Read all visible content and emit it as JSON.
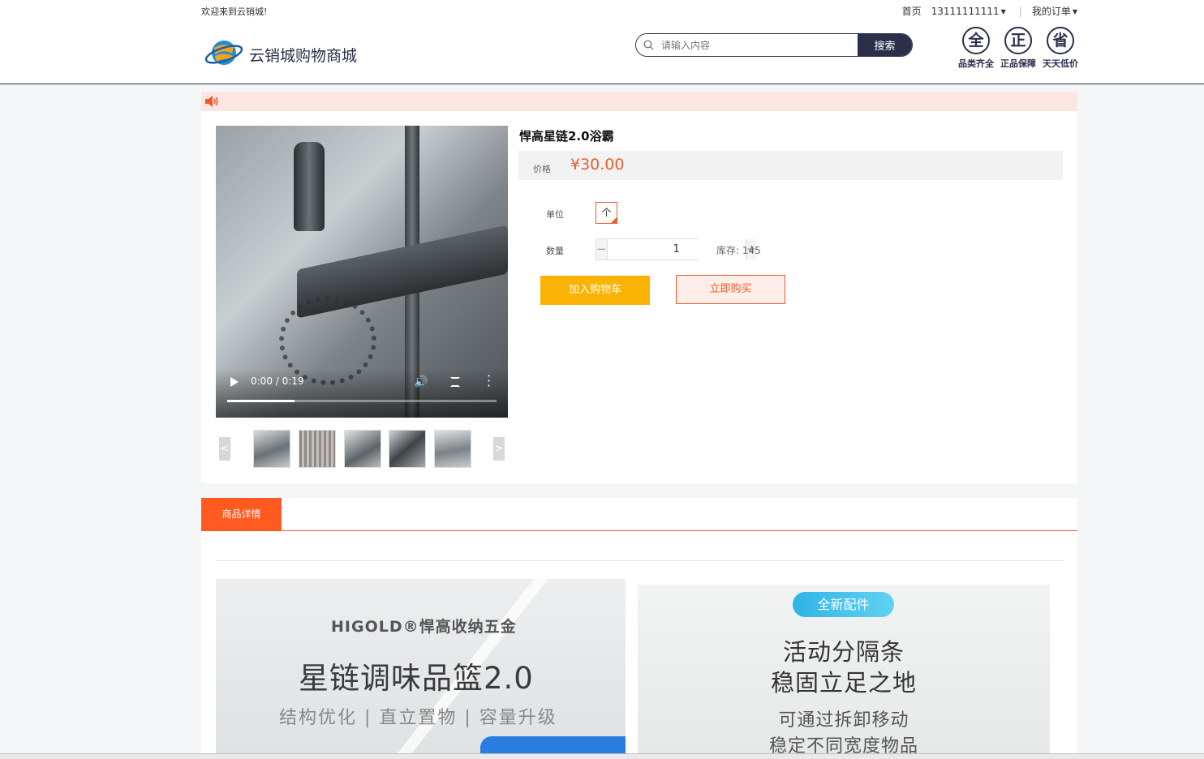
{
  "topbar": {
    "welcome": "欢迎来到云销城!",
    "home": "首页",
    "phone": "13111111111",
    "orders": "我的订单"
  },
  "site": {
    "name": "云销城购物商城",
    "logo_icon": "planet-logo-icon"
  },
  "search": {
    "placeholder": "请输入内容",
    "value": "",
    "button": "搜索"
  },
  "badges": [
    {
      "char": "全",
      "label": "品类齐全"
    },
    {
      "char": "正",
      "label": "正品保障"
    },
    {
      "char": "省",
      "label": "天天低价"
    }
  ],
  "notice": {
    "icon": "speaker-icon"
  },
  "video": {
    "time": "0:00 / 0:19",
    "progress": 0.25
  },
  "thumbs": {
    "prev": "<",
    "next": ">",
    "count": 5
  },
  "product": {
    "title": "悍高星链2.0浴霸",
    "price_label": "价格",
    "price": "¥30.00",
    "unit_label": "单位",
    "unit_value": "个",
    "qty_label": "数量",
    "qty_minus": "−",
    "qty_plus": "+",
    "qty_value": "1",
    "stock": "库存: 145",
    "add_to_cart": "加入购物车",
    "buy_now": "立即购买"
  },
  "detail": {
    "tab": "商品详情",
    "banner1": {
      "brand": "HIGOLD®悍高收纳五金",
      "title": "星链调味品篮2.0",
      "subtitle": "结构优化 | 直立置物 | 容量升级"
    },
    "banner2": {
      "tag": "全新配件",
      "line1": "活动分隔条",
      "line2": "稳固立足之地",
      "line3": "可通过拆卸移动",
      "line4": "稳定不同宽度物品"
    }
  },
  "colors": {
    "brand": "#2b2f4a",
    "accent": "#ee5b2b",
    "cart": "#fbb406"
  }
}
